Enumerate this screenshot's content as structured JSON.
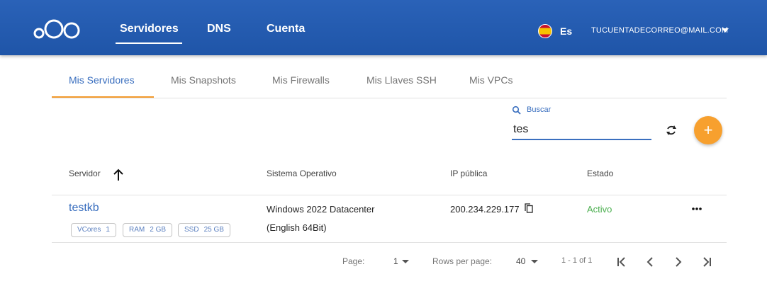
{
  "header": {
    "nav": [
      "Servidores",
      "DNS",
      "Cuenta"
    ],
    "active_nav": "Servidores",
    "language": "Es",
    "user_email": "TUCUENTADECORREO@MAIL.COM",
    "brand_color": "#2a62b8"
  },
  "tabs": [
    {
      "label": "Mis Servidores",
      "active": true
    },
    {
      "label": "Mis Snapshots",
      "active": false
    },
    {
      "label": "Mis Firewalls",
      "active": false
    },
    {
      "label": "Mis Llaves SSH",
      "active": false
    },
    {
      "label": "Mis VPCs",
      "active": false
    }
  ],
  "search": {
    "label": "Buscar",
    "value": "tes"
  },
  "table": {
    "headers": [
      "Servidor",
      "Sistema Operativo",
      "IP pública",
      "Estado"
    ],
    "rows": [
      {
        "name": "testkb",
        "chips": [
          {
            "label": "VCores",
            "value": "1"
          },
          {
            "label": "RAM",
            "value": "2 GB"
          },
          {
            "label": "SSD",
            "value": "25 GB"
          }
        ],
        "os_line1": "Windows 2022 Datacenter",
        "os_line2": "(English 64Bit)",
        "ip": "200.234.229.177",
        "status": "Activo",
        "status_color": "#4caf50"
      }
    ]
  },
  "pagination": {
    "page_label": "Page:",
    "page_value": "1",
    "rows_label": "Rows per page:",
    "rows_value": "40",
    "range": "1 - 1 of 1"
  },
  "colors": {
    "accent": "#f7a02e",
    "link": "#3a6fbf"
  }
}
